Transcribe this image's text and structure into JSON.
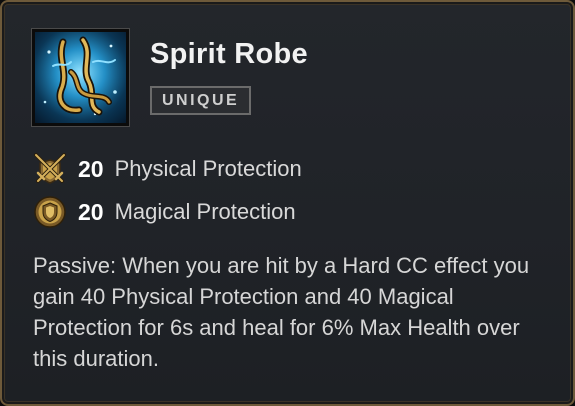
{
  "item": {
    "name": "Spirit Robe",
    "rarity": "UNIQUE",
    "icon": "spirit-robe-icon"
  },
  "stats": [
    {
      "value": "20",
      "label": "Physical Protection",
      "icon": "physical-protection-icon"
    },
    {
      "value": "20",
      "label": "Magical Protection",
      "icon": "magical-protection-icon"
    }
  ],
  "passive": "Passive: When you are hit by a Hard CC effect you gain 40 Physical Protection and 40 Magical Protection for 6s and heal for 6% Max Health over this duration.",
  "colors": {
    "border": "#6e5a3a",
    "background": "#22252a",
    "icon_gold": "#c9a24a"
  }
}
